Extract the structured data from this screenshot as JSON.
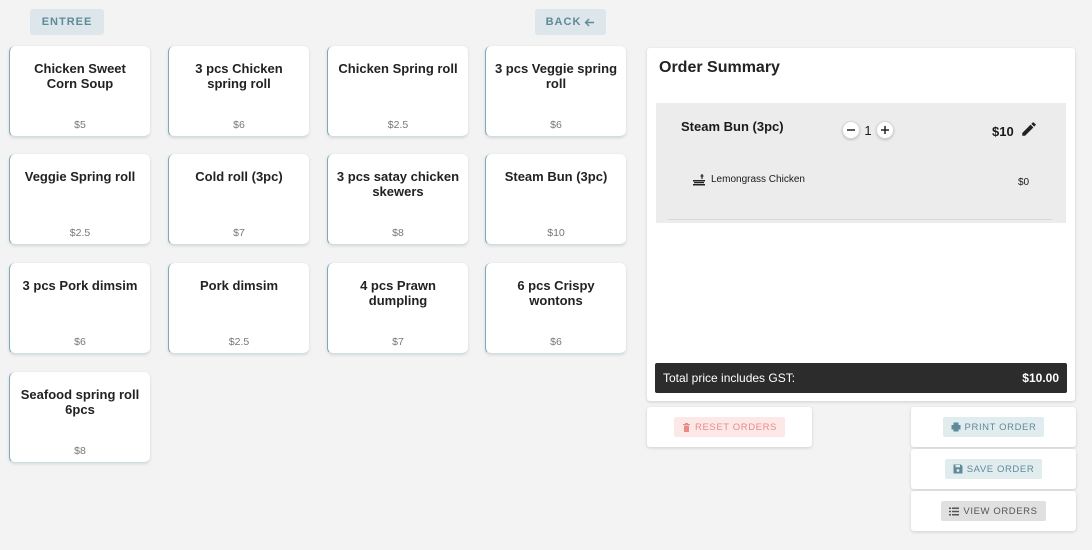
{
  "header": {
    "category_label": "ENTREE",
    "back_label": "BACK"
  },
  "menu_items": [
    {
      "name": "Chicken Sweet Corn Soup",
      "price": "$5"
    },
    {
      "name": "3 pcs Chicken spring roll",
      "price": "$6"
    },
    {
      "name": "Chicken Spring roll",
      "price": "$2.5"
    },
    {
      "name": "3 pcs Veggie spring roll",
      "price": "$6"
    },
    {
      "name": "Veggie Spring roll",
      "price": "$2.5"
    },
    {
      "name": "Cold roll (3pc)",
      "price": "$7"
    },
    {
      "name": "3 pcs satay chicken skewers",
      "price": "$8"
    },
    {
      "name": "Steam Bun (3pc)",
      "price": "$10"
    },
    {
      "name": "3 pcs Pork dimsim",
      "price": "$6"
    },
    {
      "name": "Pork dimsim",
      "price": "$2.5"
    },
    {
      "name": "4 pcs Prawn dumpling",
      "price": "$7"
    },
    {
      "name": "6 pcs Crispy wontons",
      "price": "$6"
    },
    {
      "name": "Seafood spring roll 6pcs",
      "price": "$8"
    }
  ],
  "order_summary": {
    "title": "Order Summary",
    "items": [
      {
        "name": "Steam Bun (3pc)",
        "quantity": "1",
        "price": "$10",
        "modifier": {
          "name": "Lemongrass Chicken",
          "price": "$0"
        }
      }
    ],
    "total_label": "Total price includes GST:",
    "total_value": "$10.00"
  },
  "actions": {
    "reset_label": "RESET ORDERS",
    "print_label": "PRINT ORDER",
    "save_label": "SAVE ORDER",
    "view_label": "VIEW ORDERS"
  }
}
